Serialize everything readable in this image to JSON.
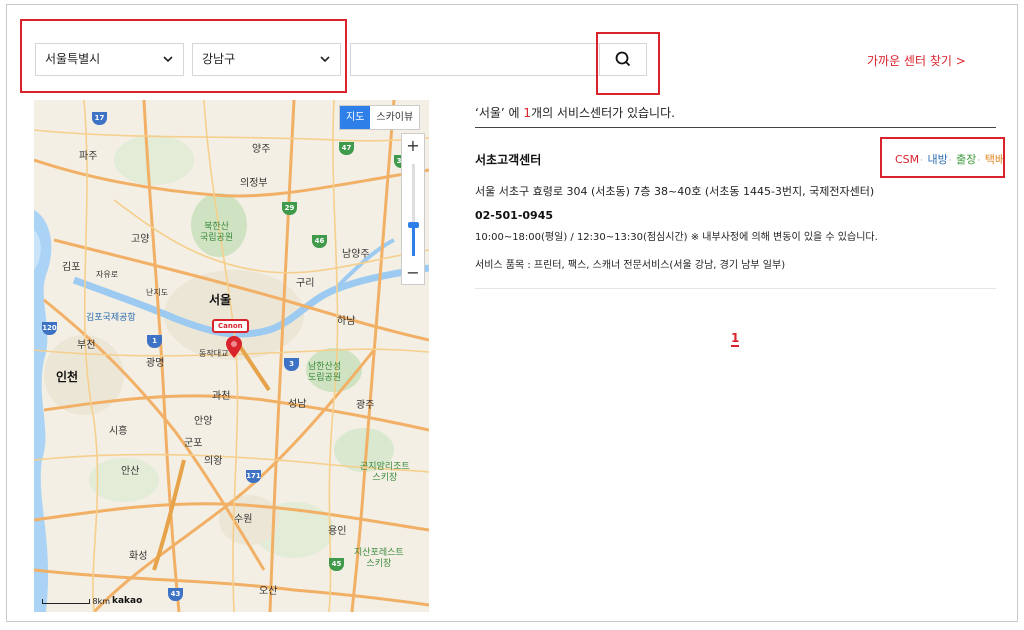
{
  "filters": {
    "city": "서울특별시",
    "district": "강남구",
    "search_value": "",
    "nearby_link": "가까운 센터 찾기 >"
  },
  "map": {
    "type_tabs": [
      "지도",
      "스카이뷰"
    ],
    "zoom_in": "+",
    "zoom_out": "−",
    "marker_label": "Canon",
    "scale": "8km",
    "logo": "kakao",
    "labels": {
      "yangju": "양주",
      "paju": "파주",
      "uijeongbu": "의정부",
      "goyang": "고양",
      "bukhansan": "북한산\n국립공원",
      "namyangju": "남양주",
      "gimpo": "김포",
      "guri": "구리",
      "seoul": "서울",
      "gimpo_airport": "김포국제공항",
      "hanam": "하남",
      "bucheon": "부천",
      "gwangmyeong": "광명",
      "incheon": "인천",
      "namhansanseong": "남한산성\n도립공원",
      "gwacheon": "과천",
      "seongnam": "성남",
      "gwangju": "광주",
      "anyang": "안양",
      "siheung": "시흥",
      "gunpo": "군포",
      "uiwang": "의왕",
      "ansan": "안산",
      "suwon": "수원",
      "yongin": "용인",
      "hwaseong": "화성",
      "osan": "오산",
      "konjiam": "곤지암리조트\n스키장",
      "jisan": "지산포레스트\n스키장",
      "dongjakdaegyo": "동작대교",
      "jayuro": "자유로",
      "nanjido": "난지도"
    }
  },
  "results": {
    "region": "‘서울’",
    "count": "1",
    "prefix": " 에 ",
    "suffix": "개의 서비스센터가 있습니다.",
    "center": {
      "name": "서초고객센터",
      "badges": {
        "csm": "CSM",
        "visit": "내방",
        "trip": "출장",
        "parcel": "택배"
      },
      "address": "서울 서초구 효령로 304 (서초동) 7층 38~40호 (서초동 1445-3번지, 국제전자센터)",
      "phone": "02-501-0945",
      "hours": "10:00~18:00(평일) / 12:30~13:30(점심시간) ※ 내부사정에 의해 변동이 있을 수 있습니다.",
      "items": "서비스 품목 : 프린터, 팩스, 스캐너 전문서비스(서울 강남, 경기 남부 일부)"
    },
    "pagination": [
      "1"
    ]
  },
  "colors": {
    "accent": "#d9232d",
    "map_tab_active": "#2f7fe8",
    "visit": "#2b6cb0",
    "trip": "#3c9a3c",
    "parcel": "#e0851c"
  }
}
